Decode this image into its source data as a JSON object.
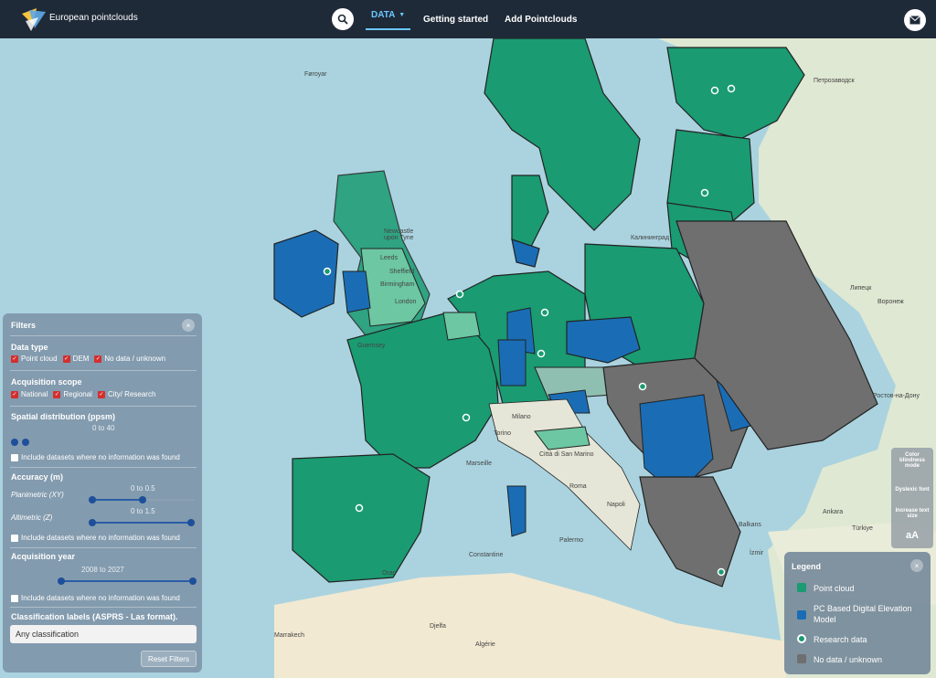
{
  "header": {
    "brand": "European pointclouds",
    "nav": {
      "data": "DATA",
      "getting_started": "Getting started",
      "add": "Add Pointclouds"
    }
  },
  "colors": {
    "point_cloud": "#1a9b72",
    "pc_dem": "#1a6db5",
    "no_data": "#6f6f6f",
    "research": "#1a9b72",
    "sea": "#aad3df",
    "header_bg": "#1f2a38",
    "accent": "#6ac7ff"
  },
  "map_labels": {
    "faroe": "Føroyar",
    "newcastle": "Newcastle upon Tyne",
    "leeds": "Leeds",
    "sheffield": "Sheffield",
    "birmingham": "Birmingham",
    "london": "London",
    "guernsey": "Guernsey",
    "milano": "Milano",
    "torino": "Torino",
    "marseille": "Marseille",
    "citta_sm": "Città di San Marino",
    "roma": "Roma",
    "napoli": "Napoli",
    "palermo": "Palermo",
    "constantine": "Constantine",
    "oran": "Oran",
    "algerie": "Algérie",
    "marrakech": "Marrakech",
    "djelfa": "Djelfa",
    "kaliningrad": "Калининград",
    "petrozavodsk": "Петрозаводск",
    "lipetsk": "Липецк",
    "voronezh": "Воронеж",
    "rostov": "Ростов-на-Дону",
    "balkans": "Balkans",
    "turkey": "Türkiye",
    "ankara": "Ankara",
    "izmir": "İzmir"
  },
  "filters": {
    "title": "Filters",
    "close": "×",
    "data_type": {
      "label": "Data type",
      "options": [
        "Point cloud",
        "DEM",
        "No data / unknown"
      ]
    },
    "scope": {
      "label": "Acquisition scope",
      "options": [
        "National",
        "Regional",
        "City/ Research"
      ]
    },
    "spatial": {
      "label": "Spatial distribution (ppsm)",
      "range": "0 to 40",
      "include": "Include datasets where no information was found"
    },
    "accuracy": {
      "label": "Accuracy (m)",
      "planimetric_label": "Planimetric (XY)",
      "planimetric_range": "0 to 0.5",
      "altimetric_label": "Altimetric (Z)",
      "altimetric_range": "0 to 1.5",
      "include": "Include datasets where no information was found"
    },
    "year": {
      "label": "Acquisition year",
      "range": "2008 to 2027",
      "include": "Include datasets where no information was found"
    },
    "classification": {
      "label": "Classification labels (ASPRS - Las format).",
      "placeholder": "Any classification"
    },
    "reset": "Reset Filters"
  },
  "accessibility": {
    "color_blind": "Color blindness mode",
    "dyslexic": "Dyslexic font",
    "increase": "Increase text size",
    "increase_glyph": "aA"
  },
  "legend": {
    "title": "Legend",
    "close": "×",
    "items": [
      "Point cloud",
      "PC Based Digital Elevation Model",
      "Research data",
      "No data / unknown"
    ]
  }
}
